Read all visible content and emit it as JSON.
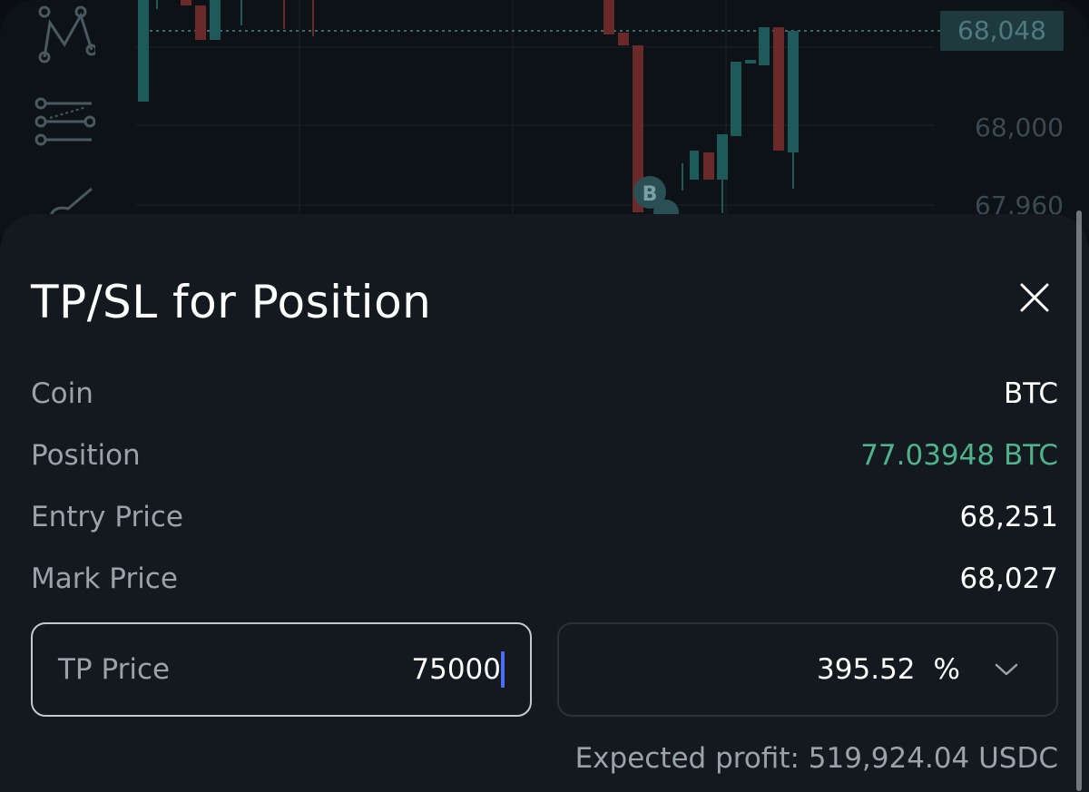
{
  "chart": {
    "current_price_tag": "68,048",
    "axis_labels": [
      "68,000",
      "67,960"
    ],
    "axis_partial_label": "68,048",
    "marker_letters": [
      "B",
      "B"
    ]
  },
  "sheet": {
    "title": "TP/SL for Position",
    "rows": [
      {
        "label": "Coin",
        "value": "BTC"
      },
      {
        "label": "Position",
        "value": "77.03948 BTC"
      },
      {
        "label": "Entry Price",
        "value": "68,251"
      },
      {
        "label": "Mark Price",
        "value": "68,027"
      }
    ],
    "tp_input": {
      "label": "TP Price",
      "value": "75000"
    },
    "pct_select": {
      "value": "395.52",
      "unit": "%"
    },
    "expected_profit": "Expected profit: 519,924.04 USDC"
  },
  "colors": {
    "background": "#13191f",
    "profit_green": "#50b28a",
    "caret_blue": "#4a6cf7",
    "label_gray": "#9aa3aa"
  },
  "icons": [
    "pattern-tool-icon",
    "fib-tool-icon",
    "brush-tool-icon",
    "close-icon",
    "chevron-down-icon"
  ]
}
